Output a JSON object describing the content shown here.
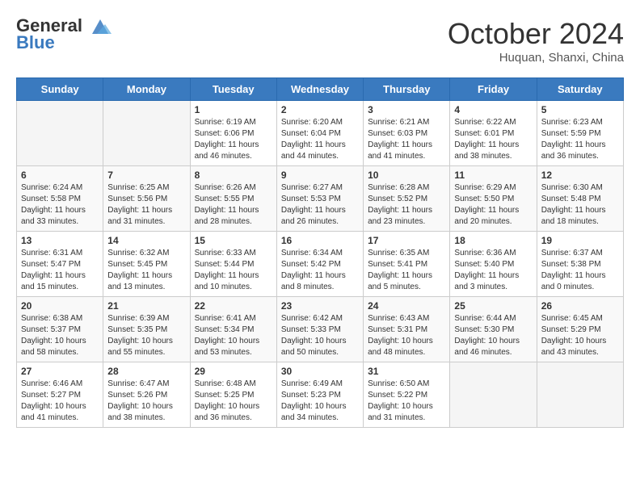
{
  "header": {
    "logo_line1": "General",
    "logo_line2": "Blue",
    "month_title": "October 2024",
    "location": "Huquan, Shanxi, China"
  },
  "days_of_week": [
    "Sunday",
    "Monday",
    "Tuesday",
    "Wednesday",
    "Thursday",
    "Friday",
    "Saturday"
  ],
  "weeks": [
    [
      {
        "day": "",
        "sunrise": "",
        "sunset": "",
        "daylight": "",
        "empty": true
      },
      {
        "day": "",
        "sunrise": "",
        "sunset": "",
        "daylight": "",
        "empty": true
      },
      {
        "day": "1",
        "sunrise": "Sunrise: 6:19 AM",
        "sunset": "Sunset: 6:06 PM",
        "daylight": "Daylight: 11 hours and 46 minutes.",
        "empty": false
      },
      {
        "day": "2",
        "sunrise": "Sunrise: 6:20 AM",
        "sunset": "Sunset: 6:04 PM",
        "daylight": "Daylight: 11 hours and 44 minutes.",
        "empty": false
      },
      {
        "day": "3",
        "sunrise": "Sunrise: 6:21 AM",
        "sunset": "Sunset: 6:03 PM",
        "daylight": "Daylight: 11 hours and 41 minutes.",
        "empty": false
      },
      {
        "day": "4",
        "sunrise": "Sunrise: 6:22 AM",
        "sunset": "Sunset: 6:01 PM",
        "daylight": "Daylight: 11 hours and 38 minutes.",
        "empty": false
      },
      {
        "day": "5",
        "sunrise": "Sunrise: 6:23 AM",
        "sunset": "Sunset: 5:59 PM",
        "daylight": "Daylight: 11 hours and 36 minutes.",
        "empty": false
      }
    ],
    [
      {
        "day": "6",
        "sunrise": "Sunrise: 6:24 AM",
        "sunset": "Sunset: 5:58 PM",
        "daylight": "Daylight: 11 hours and 33 minutes.",
        "empty": false
      },
      {
        "day": "7",
        "sunrise": "Sunrise: 6:25 AM",
        "sunset": "Sunset: 5:56 PM",
        "daylight": "Daylight: 11 hours and 31 minutes.",
        "empty": false
      },
      {
        "day": "8",
        "sunrise": "Sunrise: 6:26 AM",
        "sunset": "Sunset: 5:55 PM",
        "daylight": "Daylight: 11 hours and 28 minutes.",
        "empty": false
      },
      {
        "day": "9",
        "sunrise": "Sunrise: 6:27 AM",
        "sunset": "Sunset: 5:53 PM",
        "daylight": "Daylight: 11 hours and 26 minutes.",
        "empty": false
      },
      {
        "day": "10",
        "sunrise": "Sunrise: 6:28 AM",
        "sunset": "Sunset: 5:52 PM",
        "daylight": "Daylight: 11 hours and 23 minutes.",
        "empty": false
      },
      {
        "day": "11",
        "sunrise": "Sunrise: 6:29 AM",
        "sunset": "Sunset: 5:50 PM",
        "daylight": "Daylight: 11 hours and 20 minutes.",
        "empty": false
      },
      {
        "day": "12",
        "sunrise": "Sunrise: 6:30 AM",
        "sunset": "Sunset: 5:48 PM",
        "daylight": "Daylight: 11 hours and 18 minutes.",
        "empty": false
      }
    ],
    [
      {
        "day": "13",
        "sunrise": "Sunrise: 6:31 AM",
        "sunset": "Sunset: 5:47 PM",
        "daylight": "Daylight: 11 hours and 15 minutes.",
        "empty": false
      },
      {
        "day": "14",
        "sunrise": "Sunrise: 6:32 AM",
        "sunset": "Sunset: 5:45 PM",
        "daylight": "Daylight: 11 hours and 13 minutes.",
        "empty": false
      },
      {
        "day": "15",
        "sunrise": "Sunrise: 6:33 AM",
        "sunset": "Sunset: 5:44 PM",
        "daylight": "Daylight: 11 hours and 10 minutes.",
        "empty": false
      },
      {
        "day": "16",
        "sunrise": "Sunrise: 6:34 AM",
        "sunset": "Sunset: 5:42 PM",
        "daylight": "Daylight: 11 hours and 8 minutes.",
        "empty": false
      },
      {
        "day": "17",
        "sunrise": "Sunrise: 6:35 AM",
        "sunset": "Sunset: 5:41 PM",
        "daylight": "Daylight: 11 hours and 5 minutes.",
        "empty": false
      },
      {
        "day": "18",
        "sunrise": "Sunrise: 6:36 AM",
        "sunset": "Sunset: 5:40 PM",
        "daylight": "Daylight: 11 hours and 3 minutes.",
        "empty": false
      },
      {
        "day": "19",
        "sunrise": "Sunrise: 6:37 AM",
        "sunset": "Sunset: 5:38 PM",
        "daylight": "Daylight: 11 hours and 0 minutes.",
        "empty": false
      }
    ],
    [
      {
        "day": "20",
        "sunrise": "Sunrise: 6:38 AM",
        "sunset": "Sunset: 5:37 PM",
        "daylight": "Daylight: 10 hours and 58 minutes.",
        "empty": false
      },
      {
        "day": "21",
        "sunrise": "Sunrise: 6:39 AM",
        "sunset": "Sunset: 5:35 PM",
        "daylight": "Daylight: 10 hours and 55 minutes.",
        "empty": false
      },
      {
        "day": "22",
        "sunrise": "Sunrise: 6:41 AM",
        "sunset": "Sunset: 5:34 PM",
        "daylight": "Daylight: 10 hours and 53 minutes.",
        "empty": false
      },
      {
        "day": "23",
        "sunrise": "Sunrise: 6:42 AM",
        "sunset": "Sunset: 5:33 PM",
        "daylight": "Daylight: 10 hours and 50 minutes.",
        "empty": false
      },
      {
        "day": "24",
        "sunrise": "Sunrise: 6:43 AM",
        "sunset": "Sunset: 5:31 PM",
        "daylight": "Daylight: 10 hours and 48 minutes.",
        "empty": false
      },
      {
        "day": "25",
        "sunrise": "Sunrise: 6:44 AM",
        "sunset": "Sunset: 5:30 PM",
        "daylight": "Daylight: 10 hours and 46 minutes.",
        "empty": false
      },
      {
        "day": "26",
        "sunrise": "Sunrise: 6:45 AM",
        "sunset": "Sunset: 5:29 PM",
        "daylight": "Daylight: 10 hours and 43 minutes.",
        "empty": false
      }
    ],
    [
      {
        "day": "27",
        "sunrise": "Sunrise: 6:46 AM",
        "sunset": "Sunset: 5:27 PM",
        "daylight": "Daylight: 10 hours and 41 minutes.",
        "empty": false
      },
      {
        "day": "28",
        "sunrise": "Sunrise: 6:47 AM",
        "sunset": "Sunset: 5:26 PM",
        "daylight": "Daylight: 10 hours and 38 minutes.",
        "empty": false
      },
      {
        "day": "29",
        "sunrise": "Sunrise: 6:48 AM",
        "sunset": "Sunset: 5:25 PM",
        "daylight": "Daylight: 10 hours and 36 minutes.",
        "empty": false
      },
      {
        "day": "30",
        "sunrise": "Sunrise: 6:49 AM",
        "sunset": "Sunset: 5:23 PM",
        "daylight": "Daylight: 10 hours and 34 minutes.",
        "empty": false
      },
      {
        "day": "31",
        "sunrise": "Sunrise: 6:50 AM",
        "sunset": "Sunset: 5:22 PM",
        "daylight": "Daylight: 10 hours and 31 minutes.",
        "empty": false
      },
      {
        "day": "",
        "sunrise": "",
        "sunset": "",
        "daylight": "",
        "empty": true
      },
      {
        "day": "",
        "sunrise": "",
        "sunset": "",
        "daylight": "",
        "empty": true
      }
    ]
  ]
}
